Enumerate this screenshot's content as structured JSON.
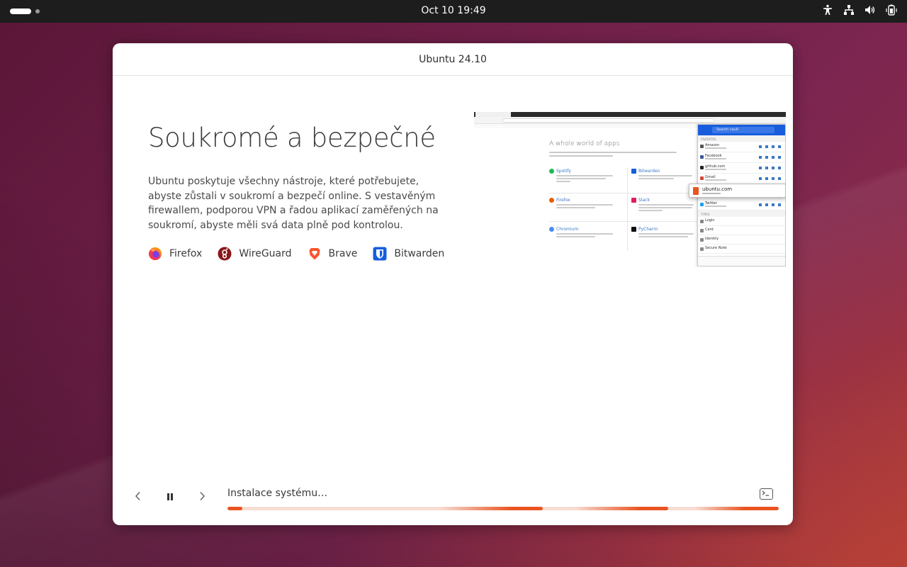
{
  "topbar": {
    "clock": "Oct 10  19:49"
  },
  "window": {
    "title": "Ubuntu 24.10"
  },
  "slide": {
    "title": "Soukromé a bezpečné",
    "body": "Ubuntu poskytuje všechny nástroje, které potřebujete, abyste zůstali v soukromí a bezpečí online. S vestavěným firewallem, podporou VPN a řadou aplikací zaměřených na soukromí, abyste měli svá data plně pod kontrolou.",
    "apps": [
      {
        "label": "Firefox",
        "icon": "firefox-icon"
      },
      {
        "label": "WireGuard",
        "icon": "wireguard-icon"
      },
      {
        "label": "Brave",
        "icon": "brave-icon"
      },
      {
        "label": "Bitwarden",
        "icon": "bitwarden-icon"
      }
    ]
  },
  "preview": {
    "heading": "A whole world of apps",
    "apps": [
      {
        "name": "Spotify",
        "color": "#1db954"
      },
      {
        "name": "Bitwarden",
        "color": "#175ddc"
      },
      {
        "name": "Firefox",
        "color": "#e66000"
      },
      {
        "name": "Slack",
        "color": "#4a154b"
      },
      {
        "name": "Chromium",
        "color": "#4a8af4"
      },
      {
        "name": "PyCharm",
        "color": "#21d789"
      }
    ],
    "bitwarden": {
      "search_placeholder": "Search vault",
      "favorites_label": "FAVORITES",
      "types_label": "TYPES",
      "items": [
        "Amazon",
        "Facebook",
        "github.com",
        "Gmail"
      ],
      "callout": "ubuntu.com",
      "after_callout": "Twitter",
      "types": [
        "Login",
        "Card",
        "Identity",
        "Secure Note"
      ]
    }
  },
  "footer": {
    "status": "Instalace systému…",
    "progress_accent": "#e95420",
    "progress_track": "#f7ddd3"
  }
}
